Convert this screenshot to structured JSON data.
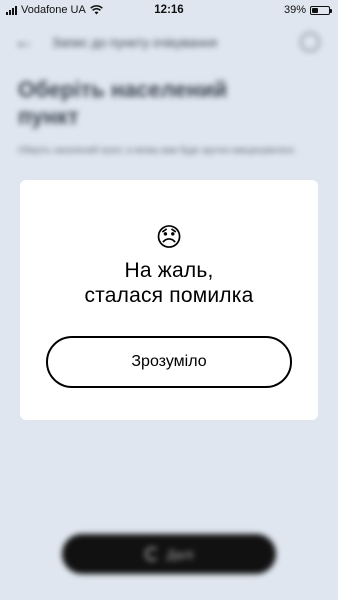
{
  "status_bar": {
    "carrier": "Vodafone UA",
    "time": "12:16",
    "battery_percent": "39%",
    "battery_level": 0.39
  },
  "background": {
    "back_icon": "arrow-left-icon",
    "header_title": "Запис до пункту очікування",
    "heading": "Оберіть населений пункт",
    "subtitle": "Оберіть населений пункт, в якому вам буде зручно вакцинуватися.",
    "go_button_label": "Далі"
  },
  "dialog": {
    "emoji": "😞",
    "title_line1": "На жаль,",
    "title_line2": "сталася помилка",
    "ok_label": "Зрозуміло"
  }
}
